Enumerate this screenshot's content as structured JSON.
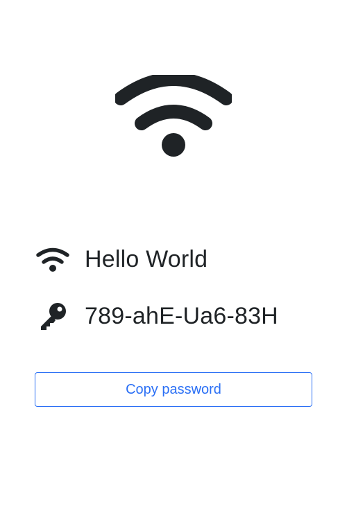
{
  "hero": {
    "icon": "wifi-icon",
    "color": "#1f2326"
  },
  "network": {
    "ssid_icon": "wifi-icon",
    "ssid": "Hello World",
    "password_icon": "key-icon",
    "password": "789-ahE-Ua6-83H"
  },
  "actions": {
    "copy_label": "Copy password",
    "accent": "#2a6ff5"
  }
}
